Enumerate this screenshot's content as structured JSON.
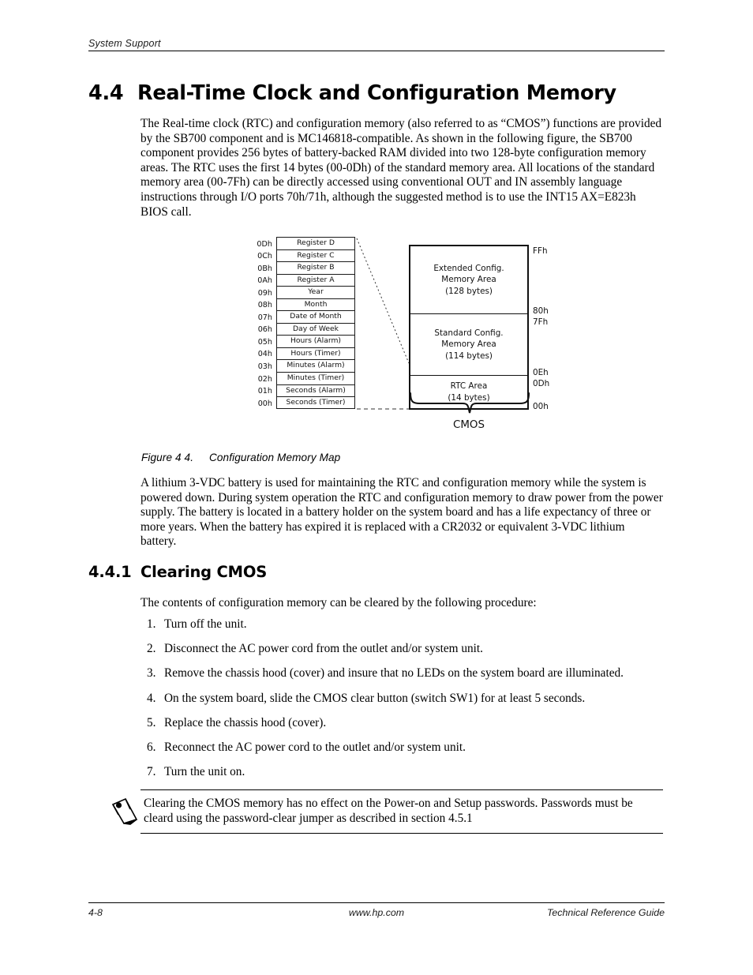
{
  "header": {
    "running_head": "System Support"
  },
  "section": {
    "number": "4.4",
    "title": "Real-Time Clock and Configuration Memory"
  },
  "intro_paragraph": "The Real-time clock (RTC) and configuration memory (also referred to as “CMOS”) functions are provided by the SB700 component and is MC146818-compatible. As shown in the following figure, the SB700 component provides 256 bytes of battery-backed RAM divided into two 128-byte configuration memory areas.  The RTC uses the first 14 bytes (00-0Dh) of the standard memory area. All locations of the standard memory area (00-7Fh) can be directly accessed using conventional OUT and IN assembly language instructions through I/O ports 70h/71h, although the suggested method is to use the INT15 AX=E823h BIOS call.",
  "figure": {
    "caption_label": "Figure 4 4.",
    "caption_text": "Configuration Memory Map",
    "register_table": [
      {
        "address": "0Dh",
        "name": "Register D"
      },
      {
        "address": "0Ch",
        "name": "Register C"
      },
      {
        "address": "0Bh",
        "name": "Register B"
      },
      {
        "address": "0Ah",
        "name": "Register A"
      },
      {
        "address": "09h",
        "name": "Year"
      },
      {
        "address": "08h",
        "name": "Month"
      },
      {
        "address": "07h",
        "name": "Date of Month"
      },
      {
        "address": "06h",
        "name": "Day of Week"
      },
      {
        "address": "05h",
        "name": "Hours (Alarm)"
      },
      {
        "address": "04h",
        "name": "Hours (Timer)"
      },
      {
        "address": "03h",
        "name": "Minutes (Alarm)"
      },
      {
        "address": "02h",
        "name": "Minutes (Timer)"
      },
      {
        "address": "01h",
        "name": "Seconds (Alarm)"
      },
      {
        "address": "00h",
        "name": "Seconds (Timer)"
      }
    ],
    "memory_areas": [
      {
        "line1": "Extended Config.",
        "line2": "Memory Area",
        "line3": "(128 bytes)"
      },
      {
        "line1": "Standard Config.",
        "line2": "Memory Area",
        "line3": "(114 bytes)"
      },
      {
        "line1": "RTC Area",
        "line2": "(14 bytes)",
        "line3": ""
      }
    ],
    "address_ticks": {
      "top": "FFh",
      "ext_bottom": "80h",
      "std_top": "7Fh",
      "std_bottom": "0Eh",
      "rtc_top": "0Dh",
      "rtc_bottom": "00h"
    },
    "bracket_label": "CMOS"
  },
  "battery_paragraph": "A lithium 3-VDC battery is used for maintaining the RTC and configuration memory while the system is powered down. During system operation the RTC and configuration memory to draw power from the power supply. The battery is located in a battery holder on the system board and has a life expectancy of three or more years. When the battery has expired it is replaced with a CR2032 or equivalent 3-VDC lithium battery.",
  "subsection": {
    "number": "4.4.1",
    "title": "Clearing CMOS"
  },
  "procedure_intro": "The contents of configuration memory can be cleared by the following procedure:",
  "procedure_steps": [
    {
      "marker": "1.",
      "text": "Turn off the unit."
    },
    {
      "marker": "2.",
      "text": "Disconnect the AC power cord from the outlet and/or system unit."
    },
    {
      "marker": "3.",
      "text": "Remove the chassis hood (cover) and insure that no LEDs on the system board are illuminated."
    },
    {
      "marker": "4.",
      "text": "On the system board, slide the CMOS clear button (switch SW1) for at least 5 seconds."
    },
    {
      "marker": "5.",
      "text": "Replace the chassis hood (cover)."
    },
    {
      "marker": "6.",
      "text": "Reconnect the AC power cord to the outlet and/or system unit."
    },
    {
      "marker": "7.",
      "text": "Turn the unit on."
    }
  ],
  "note": {
    "icon": "pencil-icon",
    "text": "Clearing the CMOS memory has no effect on the Power-on and Setup passwords. Passwords must be cleard using the password-clear jumper as described in section 4.5.1"
  },
  "footer": {
    "page_number": "4-8",
    "url": "www.hp.com",
    "guide_title": "Technical Reference Guide"
  },
  "colors": {
    "text": "#000000",
    "rule": "#000000",
    "figure_stroke": "#111111"
  }
}
